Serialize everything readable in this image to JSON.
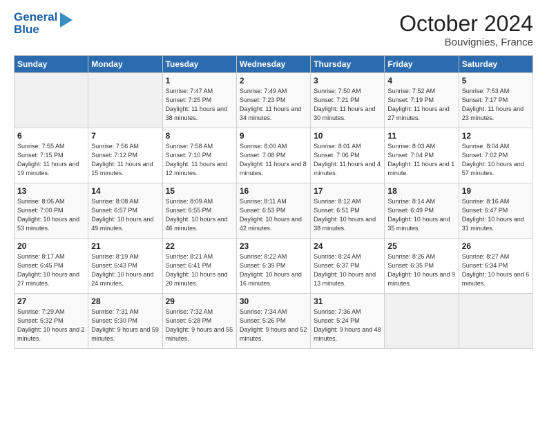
{
  "header": {
    "logo_line1": "General",
    "logo_line2": "Blue",
    "month": "October 2024",
    "location": "Bouvignies, France"
  },
  "days_of_week": [
    "Sunday",
    "Monday",
    "Tuesday",
    "Wednesday",
    "Thursday",
    "Friday",
    "Saturday"
  ],
  "weeks": [
    [
      {
        "num": "",
        "info": ""
      },
      {
        "num": "",
        "info": ""
      },
      {
        "num": "1",
        "info": "Sunrise: 7:47 AM\nSunset: 7:25 PM\nDaylight: 11 hours and 38 minutes."
      },
      {
        "num": "2",
        "info": "Sunrise: 7:49 AM\nSunset: 7:23 PM\nDaylight: 11 hours and 34 minutes."
      },
      {
        "num": "3",
        "info": "Sunrise: 7:50 AM\nSunset: 7:21 PM\nDaylight: 11 hours and 30 minutes."
      },
      {
        "num": "4",
        "info": "Sunrise: 7:52 AM\nSunset: 7:19 PM\nDaylight: 11 hours and 27 minutes."
      },
      {
        "num": "5",
        "info": "Sunrise: 7:53 AM\nSunset: 7:17 PM\nDaylight: 11 hours and 23 minutes."
      }
    ],
    [
      {
        "num": "6",
        "info": "Sunrise: 7:55 AM\nSunset: 7:15 PM\nDaylight: 11 hours and 19 minutes."
      },
      {
        "num": "7",
        "info": "Sunrise: 7:56 AM\nSunset: 7:12 PM\nDaylight: 11 hours and 15 minutes."
      },
      {
        "num": "8",
        "info": "Sunrise: 7:58 AM\nSunset: 7:10 PM\nDaylight: 11 hours and 12 minutes."
      },
      {
        "num": "9",
        "info": "Sunrise: 8:00 AM\nSunset: 7:08 PM\nDaylight: 11 hours and 8 minutes."
      },
      {
        "num": "10",
        "info": "Sunrise: 8:01 AM\nSunset: 7:06 PM\nDaylight: 11 hours and 4 minutes."
      },
      {
        "num": "11",
        "info": "Sunrise: 8:03 AM\nSunset: 7:04 PM\nDaylight: 11 hours and 1 minute."
      },
      {
        "num": "12",
        "info": "Sunrise: 8:04 AM\nSunset: 7:02 PM\nDaylight: 10 hours and 57 minutes."
      }
    ],
    [
      {
        "num": "13",
        "info": "Sunrise: 8:06 AM\nSunset: 7:00 PM\nDaylight: 10 hours and 53 minutes."
      },
      {
        "num": "14",
        "info": "Sunrise: 8:08 AM\nSunset: 6:57 PM\nDaylight: 10 hours and 49 minutes."
      },
      {
        "num": "15",
        "info": "Sunrise: 8:09 AM\nSunset: 6:55 PM\nDaylight: 10 hours and 46 minutes."
      },
      {
        "num": "16",
        "info": "Sunrise: 8:11 AM\nSunset: 6:53 PM\nDaylight: 10 hours and 42 minutes."
      },
      {
        "num": "17",
        "info": "Sunrise: 8:12 AM\nSunset: 6:51 PM\nDaylight: 10 hours and 38 minutes."
      },
      {
        "num": "18",
        "info": "Sunrise: 8:14 AM\nSunset: 6:49 PM\nDaylight: 10 hours and 35 minutes."
      },
      {
        "num": "19",
        "info": "Sunrise: 8:16 AM\nSunset: 6:47 PM\nDaylight: 10 hours and 31 minutes."
      }
    ],
    [
      {
        "num": "20",
        "info": "Sunrise: 8:17 AM\nSunset: 6:45 PM\nDaylight: 10 hours and 27 minutes."
      },
      {
        "num": "21",
        "info": "Sunrise: 8:19 AM\nSunset: 6:43 PM\nDaylight: 10 hours and 24 minutes."
      },
      {
        "num": "22",
        "info": "Sunrise: 8:21 AM\nSunset: 6:41 PM\nDaylight: 10 hours and 20 minutes."
      },
      {
        "num": "23",
        "info": "Sunrise: 8:22 AM\nSunset: 6:39 PM\nDaylight: 10 hours and 16 minutes."
      },
      {
        "num": "24",
        "info": "Sunrise: 8:24 AM\nSunset: 6:37 PM\nDaylight: 10 hours and 13 minutes."
      },
      {
        "num": "25",
        "info": "Sunrise: 8:26 AM\nSunset: 6:35 PM\nDaylight: 10 hours and 9 minutes."
      },
      {
        "num": "26",
        "info": "Sunrise: 8:27 AM\nSunset: 6:34 PM\nDaylight: 10 hours and 6 minutes."
      }
    ],
    [
      {
        "num": "27",
        "info": "Sunrise: 7:29 AM\nSunset: 5:32 PM\nDaylight: 10 hours and 2 minutes."
      },
      {
        "num": "28",
        "info": "Sunrise: 7:31 AM\nSunset: 5:30 PM\nDaylight: 9 hours and 59 minutes."
      },
      {
        "num": "29",
        "info": "Sunrise: 7:32 AM\nSunset: 5:28 PM\nDaylight: 9 hours and 55 minutes."
      },
      {
        "num": "30",
        "info": "Sunrise: 7:34 AM\nSunset: 5:26 PM\nDaylight: 9 hours and 52 minutes."
      },
      {
        "num": "31",
        "info": "Sunrise: 7:36 AM\nSunset: 5:24 PM\nDaylight: 9 hours and 48 minutes."
      },
      {
        "num": "",
        "info": ""
      },
      {
        "num": "",
        "info": ""
      }
    ]
  ]
}
